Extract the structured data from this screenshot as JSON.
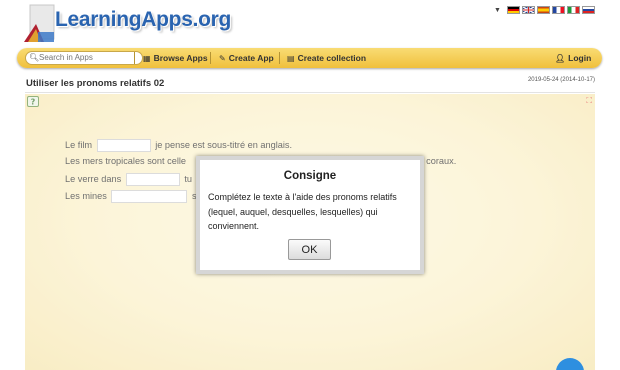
{
  "header": {
    "logo_text": "LearningApps.org",
    "flags": [
      "de-flag",
      "gb-flag",
      "es-flag",
      "fr-flag",
      "it-flag",
      "ru-flag"
    ]
  },
  "nav": {
    "search_placeholder": "Search in Apps",
    "browse": "Browse Apps",
    "create": "Create App",
    "collection": "Create collection",
    "login": "Login"
  },
  "page": {
    "title": "Utiliser les pronoms relatifs 02",
    "date": "2019-05-24 (2014-10-17)"
  },
  "exercise": {
    "line1_before": "Le film",
    "line1_after": "je pense est sous-titré en anglais.",
    "line2_before": "Les mers tropicales sont celle",
    "line2_after": "x coraux.",
    "line3_before": "Le verre dans",
    "line3_after": "tu",
    "line4_before": "Les mines",
    "line4_after": "s"
  },
  "modal": {
    "title": "Consigne",
    "text": "Complétez le texte à l'aide des pronoms relatifs (lequel, auquel, desquelles, lesquelles) qui conviennent.",
    "ok": "OK"
  },
  "colors": {
    "brand_blue": "#2a64b0",
    "nav_yellow": "#f0c03c",
    "app_bg": "#faefc4",
    "fab_blue": "#2e8fe0"
  }
}
